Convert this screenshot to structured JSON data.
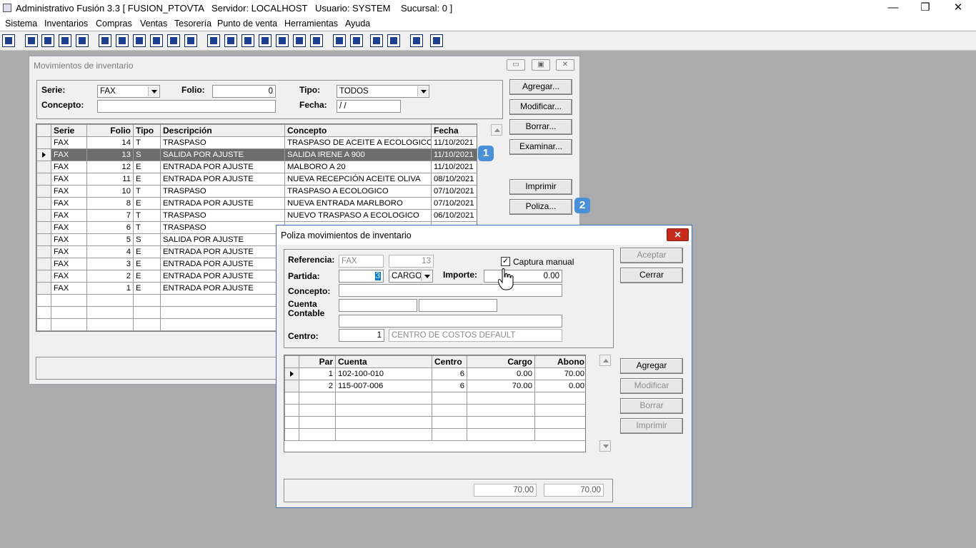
{
  "app": {
    "title": "Administrativo Fusión 3.3 [ FUSION_PTOVTA   Servidor: LOCALHOST   Usuario: SYSTEM    Sucursal: 0 ]",
    "controls": {
      "minimize": "—",
      "restore": "❐",
      "close": "✕"
    }
  },
  "menu": [
    "Sistema",
    "Inventarios",
    "Compras",
    "Ventas",
    "Tesorería",
    "Punto de venta",
    "Herramientas",
    "Ayuda"
  ],
  "toolbar_icons": [
    "network-icon",
    "copy-icon",
    "clipboard-icon",
    "swap-icon",
    "find-icon",
    "user-icon",
    "open-icon",
    "print-icon",
    "printer-icon",
    "document-icon",
    "list-icon",
    "binoculars-icon",
    "window-icon",
    "export-icon",
    "plus-icon",
    "dollar-icon",
    "page-icon",
    "report-icon",
    "home-icon",
    "zoom-icon",
    "refresh-icon",
    "undo-icon",
    "back-icon",
    "help-icon"
  ],
  "inventario": {
    "title": "Movimientos de inventario",
    "serie_label": "Serie:",
    "serie_value": "FAX",
    "folio_label": "Folio:",
    "folio_value": "0",
    "tipo_label": "Tipo:",
    "tipo_value": "TODOS",
    "concepto_label": "Concepto:",
    "concepto_value": "",
    "fecha_label": "Fecha:",
    "fecha_value": " / /",
    "buttons": {
      "agregar": "Agregar...",
      "modificar": "Modificar...",
      "borrar": "Borrar...",
      "examinar": "Examinar...",
      "imprimir": "Imprimir",
      "poliza": "Poliza..."
    },
    "columns": [
      "Serie",
      "Folio",
      "Tipo",
      "Descripción",
      "Concepto",
      "Fecha"
    ],
    "rows": [
      [
        "FAX",
        "14",
        "T",
        "TRASPASO",
        "TRASPASO DE ACEITE A ECOLOGICO",
        "11/10/2021"
      ],
      [
        "FAX",
        "13",
        "S",
        "SALIDA POR AJUSTE",
        "SALIDA IRENE A 900",
        "11/10/2021"
      ],
      [
        "FAX",
        "12",
        "E",
        "ENTRADA POR AJUSTE",
        "MALBORO A 20",
        "11/10/2021"
      ],
      [
        "FAX",
        "11",
        "E",
        "ENTRADA POR AJUSTE",
        "NUEVA RECEPCIÓN ACEITE OLIVA",
        "08/10/2021"
      ],
      [
        "FAX",
        "10",
        "T",
        "TRASPASO",
        "TRASPASO A ECOLOGICO",
        "07/10/2021"
      ],
      [
        "FAX",
        "8",
        "E",
        "ENTRADA POR AJUSTE",
        "NUEVA ENTRADA MARLBORO",
        "07/10/2021"
      ],
      [
        "FAX",
        "7",
        "T",
        "TRASPASO",
        "NUEVO TRASPASO A ECOLOGICO",
        "06/10/2021"
      ],
      [
        "FAX",
        "6",
        "T",
        "TRASPASO",
        "",
        ""
      ],
      [
        "FAX",
        "5",
        "S",
        "SALIDA POR AJUSTE",
        "",
        ""
      ],
      [
        "FAX",
        "4",
        "E",
        "ENTRADA POR AJUSTE",
        "",
        ""
      ],
      [
        "FAX",
        "3",
        "E",
        "ENTRADA POR AJUSTE",
        "",
        ""
      ],
      [
        "FAX",
        "2",
        "E",
        "ENTRADA POR AJUSTE",
        "",
        ""
      ],
      [
        "FAX",
        "1",
        "E",
        "ENTRADA POR AJUSTE",
        "",
        ""
      ]
    ],
    "selected_row": 1,
    "badge1": "1",
    "badge2": "2"
  },
  "poliza": {
    "title": "Poliza movimientos de inventario",
    "referencia_label": "Referencia:",
    "referencia_serie": "FAX",
    "referencia_folio": "13",
    "captura_manual_label": "Captura manual",
    "captura_manual_checked": true,
    "partida_label": "Partida:",
    "partida_value": "3",
    "partida_tipo": "CARGO",
    "importe_label": "Importe:",
    "importe_value": "0.00",
    "concepto_label": "Concepto:",
    "concepto_value": "",
    "cuenta_label_1": "Cuenta",
    "cuenta_label_2": "Contable",
    "centro_label": "Centro:",
    "centro_value": "1",
    "centro_desc": "CENTRO DE COSTOS DEFAULT",
    "buttons": {
      "aceptar": "Aceptar",
      "cerrar": "Cerrar",
      "agregar": "Agregar",
      "modificar": "Modificar",
      "borrar": "Borrar",
      "imprimir": "Imprimir"
    },
    "columns": [
      "Par",
      "Cuenta",
      "Centro",
      "Cargo",
      "Abono"
    ],
    "rows": [
      [
        "1",
        "102-100-010",
        "6",
        "0.00",
        "70.00"
      ],
      [
        "2",
        "115-007-006",
        "6",
        "70.00",
        "0.00"
      ]
    ],
    "total_cargo": "70.00",
    "total_abono": "70.00"
  }
}
